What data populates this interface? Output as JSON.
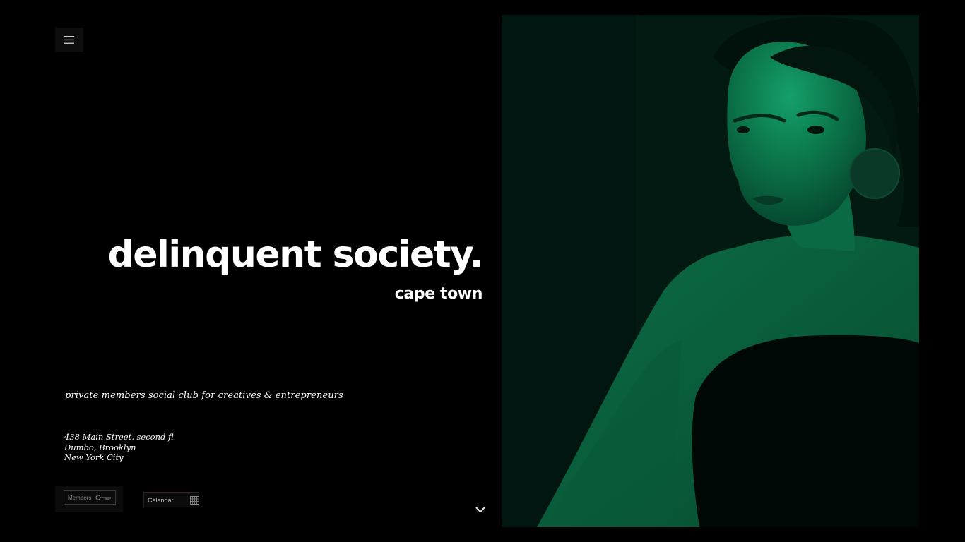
{
  "brand": {
    "title": "delinquent society.",
    "city": "cape town"
  },
  "tagline": "private members social club for creatives & entrepreneurs",
  "address": {
    "line1": "438 Main Street, second fl",
    "line2": "Dumbo, Brooklyn",
    "line3": "New York City"
  },
  "buttons": {
    "members_label": "Members",
    "calendar_label": "Calendar"
  },
  "icons": {
    "menu": "hamburger-menu-icon",
    "members": "key-icon",
    "calendar": "calendar-grid-icon",
    "scroll": "chevron-down-icon"
  },
  "colors": {
    "background": "#000000",
    "text": "#ffffff",
    "hero_tint": "#0b6b45",
    "hero_shadow": "#031a13"
  }
}
